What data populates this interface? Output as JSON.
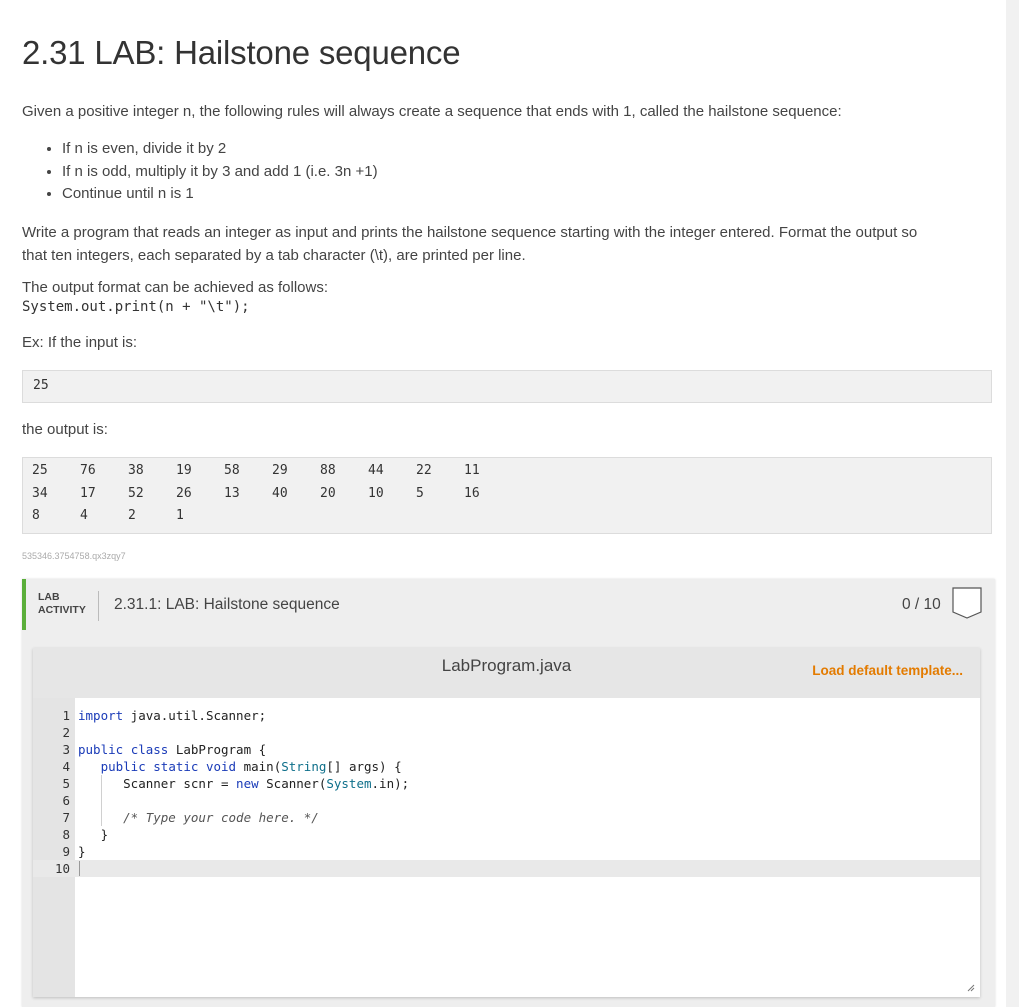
{
  "title": "2.31 LAB: Hailstone sequence",
  "intro": "Given a positive integer n, the following rules will always create a sequence that ends with 1, called the hailstone sequence:",
  "rules": [
    "If n is even, divide it by 2",
    "If n is odd, multiply it by 3 and add 1 (i.e. 3n +1)",
    "Continue until n is 1"
  ],
  "prompt_line1": "Write a program that reads an integer as input and prints the hailstone sequence starting with the integer entered. Format the output so",
  "prompt_line2": "that ten integers, each separated by a tab character (\\t), are printed per line.",
  "format_intro": "The output format can be achieved as follows:",
  "format_code": "System.out.print(n + \"\\t\");",
  "example_intro": "Ex: If the input is:",
  "example_input": "25",
  "output_intro": "the output is:",
  "example_output": [
    [
      "25",
      "76",
      "38",
      "19",
      "58",
      "29",
      "88",
      "44",
      "22",
      "11"
    ],
    [
      "34",
      "17",
      "52",
      "26",
      "13",
      "40",
      "20",
      "10",
      "5",
      "16"
    ],
    [
      "8",
      "4",
      "2",
      "1"
    ]
  ],
  "footnote": "535346.3754758.qx3zqy7",
  "lab": {
    "tag_line1": "LAB",
    "tag_line2": "ACTIVITY",
    "name": "2.31.1: LAB: Hailstone sequence",
    "score": "0 / 10",
    "filename": "LabProgram.java",
    "load_template": "Load default template...",
    "badge_icon": "badge-icon",
    "accent_color": "#5aae3a",
    "link_color": "#e37b00"
  },
  "code_lines": [
    {
      "n": "1",
      "text": "import java.util.Scanner;"
    },
    {
      "n": "2",
      "text": ""
    },
    {
      "n": "3",
      "text": "public class LabProgram {"
    },
    {
      "n": "4",
      "text": "   public static void main(String[] args) {"
    },
    {
      "n": "5",
      "text": "      Scanner scnr = new Scanner(System.in);"
    },
    {
      "n": "6",
      "text": ""
    },
    {
      "n": "7",
      "text": "      /* Type your code here. */"
    },
    {
      "n": "8",
      "text": "   }"
    },
    {
      "n": "9",
      "text": "}"
    },
    {
      "n": "10",
      "text": ""
    }
  ]
}
